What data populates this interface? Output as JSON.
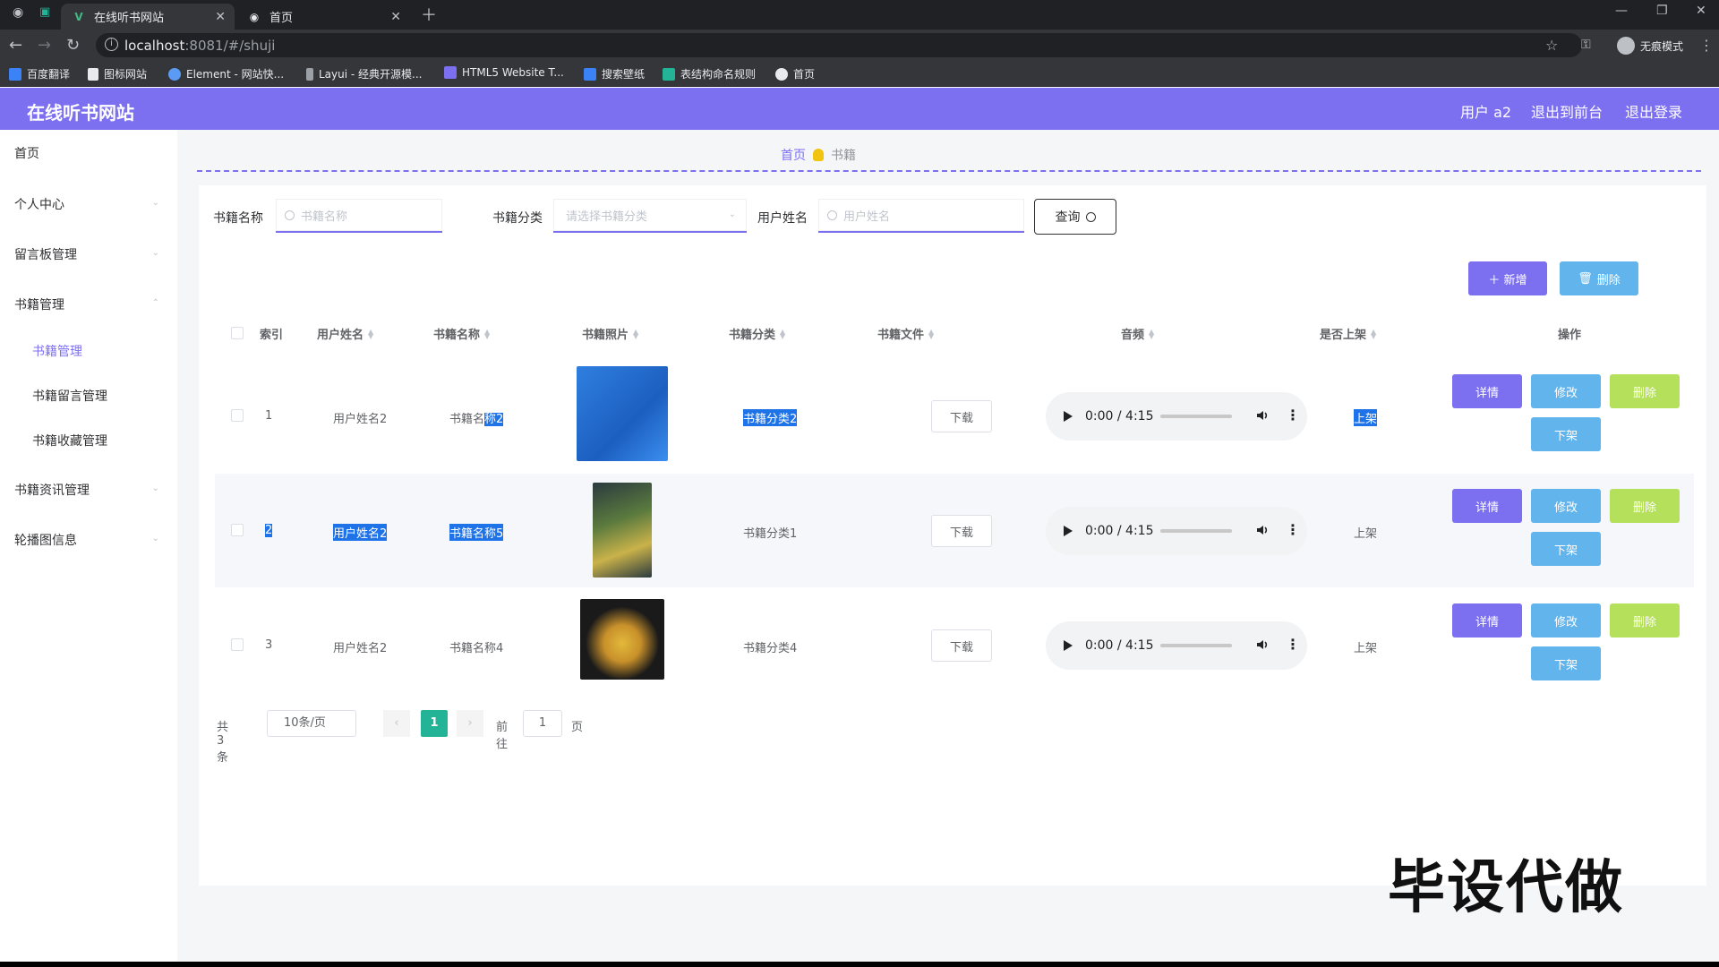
{
  "browser": {
    "tabs": [
      {
        "title": "在线听书网站",
        "active": true
      },
      {
        "title": "首页",
        "active": false
      }
    ],
    "url_host": "localhost",
    "url_rest": ":8081/#/shuji",
    "bookmarks": [
      "百度翻译",
      "图标网站",
      "Element - 网站快...",
      "Layui - 经典开源模...",
      "HTML5 Website T...",
      "搜索壁纸",
      "表结构命名规则",
      "首页"
    ],
    "profile_label": "无痕模式"
  },
  "header": {
    "title": "在线听书网站",
    "user": "用户 a2",
    "to_front": "退出到前台",
    "logout": "退出登录"
  },
  "sidebar": {
    "items": [
      "首页",
      "个人中心",
      "留言板管理",
      "书籍管理",
      "书籍资讯管理",
      "轮播图信息"
    ],
    "subitems": [
      "书籍管理",
      "书籍留言管理",
      "书籍收藏管理"
    ]
  },
  "breadcrumb": {
    "home": "首页",
    "current": "书籍"
  },
  "filters": {
    "name_label": "书籍名称",
    "name_placeholder": "书籍名称",
    "category_label": "书籍分类",
    "category_placeholder": "请选择书籍分类",
    "user_label": "用户姓名",
    "user_placeholder": "用户姓名",
    "query_button": "查询"
  },
  "actions": {
    "add": "＋ 新增",
    "delete": "删除"
  },
  "table": {
    "headers": [
      "索引",
      "用户姓名",
      "书籍名称",
      "书籍照片",
      "书籍分类",
      "书籍文件",
      "音频",
      "是否上架",
      "操作"
    ],
    "rows": [
      {
        "index": "1",
        "user": "用户姓名2",
        "book_a": "书籍名",
        "book_b": "称2",
        "category": "书籍分类2",
        "download": "下载",
        "time": "0:00 / 4:15",
        "shelf": "上架"
      },
      {
        "index": "2",
        "user": "用户姓名2",
        "book_a": "",
        "book_b": "书籍名称5",
        "category": "书籍分类1",
        "download": "下载",
        "time": "0:00 / 4:15",
        "shelf": "上架"
      },
      {
        "index": "3",
        "user": "用户姓名2",
        "book_a": "书籍名称4",
        "book_b": "",
        "category": "书籍分类4",
        "download": "下载",
        "time": "0:00 / 4:15",
        "shelf": "上架"
      }
    ],
    "ops": {
      "detail": "详情",
      "edit": "修改",
      "delete": "删除",
      "off": "下架"
    }
  },
  "pager": {
    "total": "共 3 条",
    "size": "10条/页",
    "current": "1",
    "goto": "前往",
    "goto_value": "1",
    "unit": "页"
  },
  "watermark": "毕设代做",
  "colors": {
    "primary": "#7c6ff0",
    "info": "#62b4ec",
    "success": "#b4e05c",
    "pager": "#23b397",
    "selection": "#1e73e8"
  }
}
